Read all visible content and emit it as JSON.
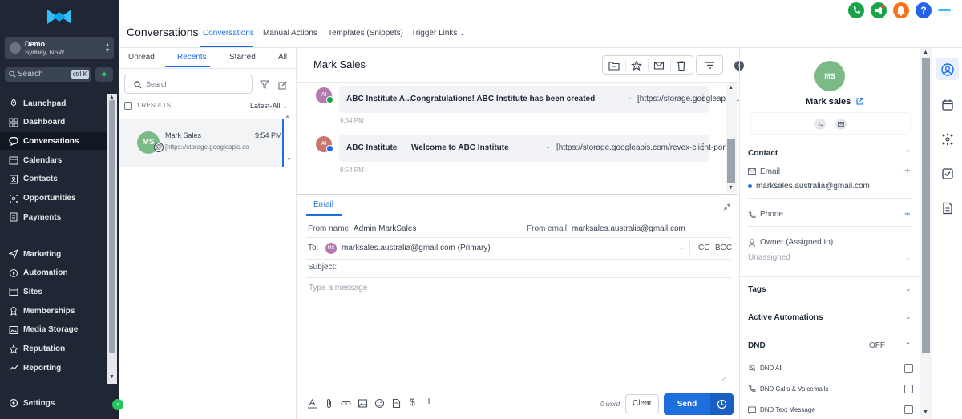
{
  "sidebar": {
    "account": {
      "name": "Demo",
      "location": "Sydney, NSW"
    },
    "search": {
      "placeholder": "Search",
      "shortcut": "ctrl K"
    },
    "items": [
      {
        "label": "Launchpad",
        "icon": "launchpad-icon"
      },
      {
        "label": "Dashboard",
        "icon": "dashboard-icon"
      },
      {
        "label": "Conversations",
        "icon": "chat-icon",
        "active": true
      },
      {
        "label": "Calendars",
        "icon": "calendar-icon"
      },
      {
        "label": "Contacts",
        "icon": "contacts-icon"
      },
      {
        "label": "Opportunities",
        "icon": "opportunities-icon"
      },
      {
        "label": "Payments",
        "icon": "payments-icon"
      }
    ],
    "items2": [
      {
        "label": "Marketing",
        "icon": "send-icon"
      },
      {
        "label": "Automation",
        "icon": "automation-icon"
      },
      {
        "label": "Sites",
        "icon": "sites-icon"
      },
      {
        "label": "Memberships",
        "icon": "memberships-icon"
      },
      {
        "label": "Media Storage",
        "icon": "media-icon"
      },
      {
        "label": "Reputation",
        "icon": "star-icon"
      },
      {
        "label": "Reporting",
        "icon": "reporting-icon"
      }
    ],
    "settings": "Settings"
  },
  "header": {
    "title": "Conversations",
    "tabs": [
      "Conversations",
      "Manual Actions",
      "Templates (Snippets)",
      "Trigger Links"
    ]
  },
  "list": {
    "tabs": [
      "Unread",
      "Recents",
      "Starred",
      "All"
    ],
    "search_placeholder": "Search",
    "results": "1 RESULTS",
    "sort": "Latest-All",
    "item": {
      "initials": "MS",
      "name": "Mark Sales",
      "time": "9:54 PM",
      "preview": "[https://storage.googleapis.co"
    }
  },
  "thread": {
    "title": "Mark Sales",
    "messages": [
      {
        "from": "ABC Institute A...",
        "subject": "Congratulations! ABC Institute has been created",
        "link": "[https://storage.googleapis....",
        "time": "9:54 PM",
        "initials": "AI"
      },
      {
        "from": "ABC Institute",
        "subject": "Welcome to ABC Institute",
        "link": "[https://storage.googleapis.com/revex-client-port...",
        "time": "9:54 PM",
        "initials": "AI"
      }
    ]
  },
  "composer": {
    "tab": "Email",
    "from_name_label": "From name:",
    "from_name": "Admin MarkSales",
    "from_email_label": "From email:",
    "from_email": "marksales.australia@gmail.com",
    "to_label": "To:",
    "to_initials": "MS",
    "to_value": "marksales.australia@gmail.com (Primary)",
    "cc": "CC",
    "bcc": "BCC",
    "subject_label": "Subject:",
    "placeholder": "Type a message",
    "word_count": "0 word",
    "clear": "Clear",
    "send": "Send"
  },
  "contact": {
    "initials": "MS",
    "name": "Mark sales",
    "section_contact": "Contact",
    "email_label": "Email",
    "email": "marksales.australia@gmail.com",
    "phone_label": "Phone",
    "owner_label": "Owner (Assigned to)",
    "owner_value": "Unassigned",
    "tags": "Tags",
    "active_automations": "Active Automations",
    "dnd": "DND",
    "dnd_state": "OFF",
    "dnd_items": [
      "DND All",
      "DND Calls & Voicemails",
      "DND Text Message"
    ]
  },
  "colors": {
    "accent": "#1d6fe0",
    "sidebar": "#1e2733",
    "avatar": "#7bb987"
  }
}
